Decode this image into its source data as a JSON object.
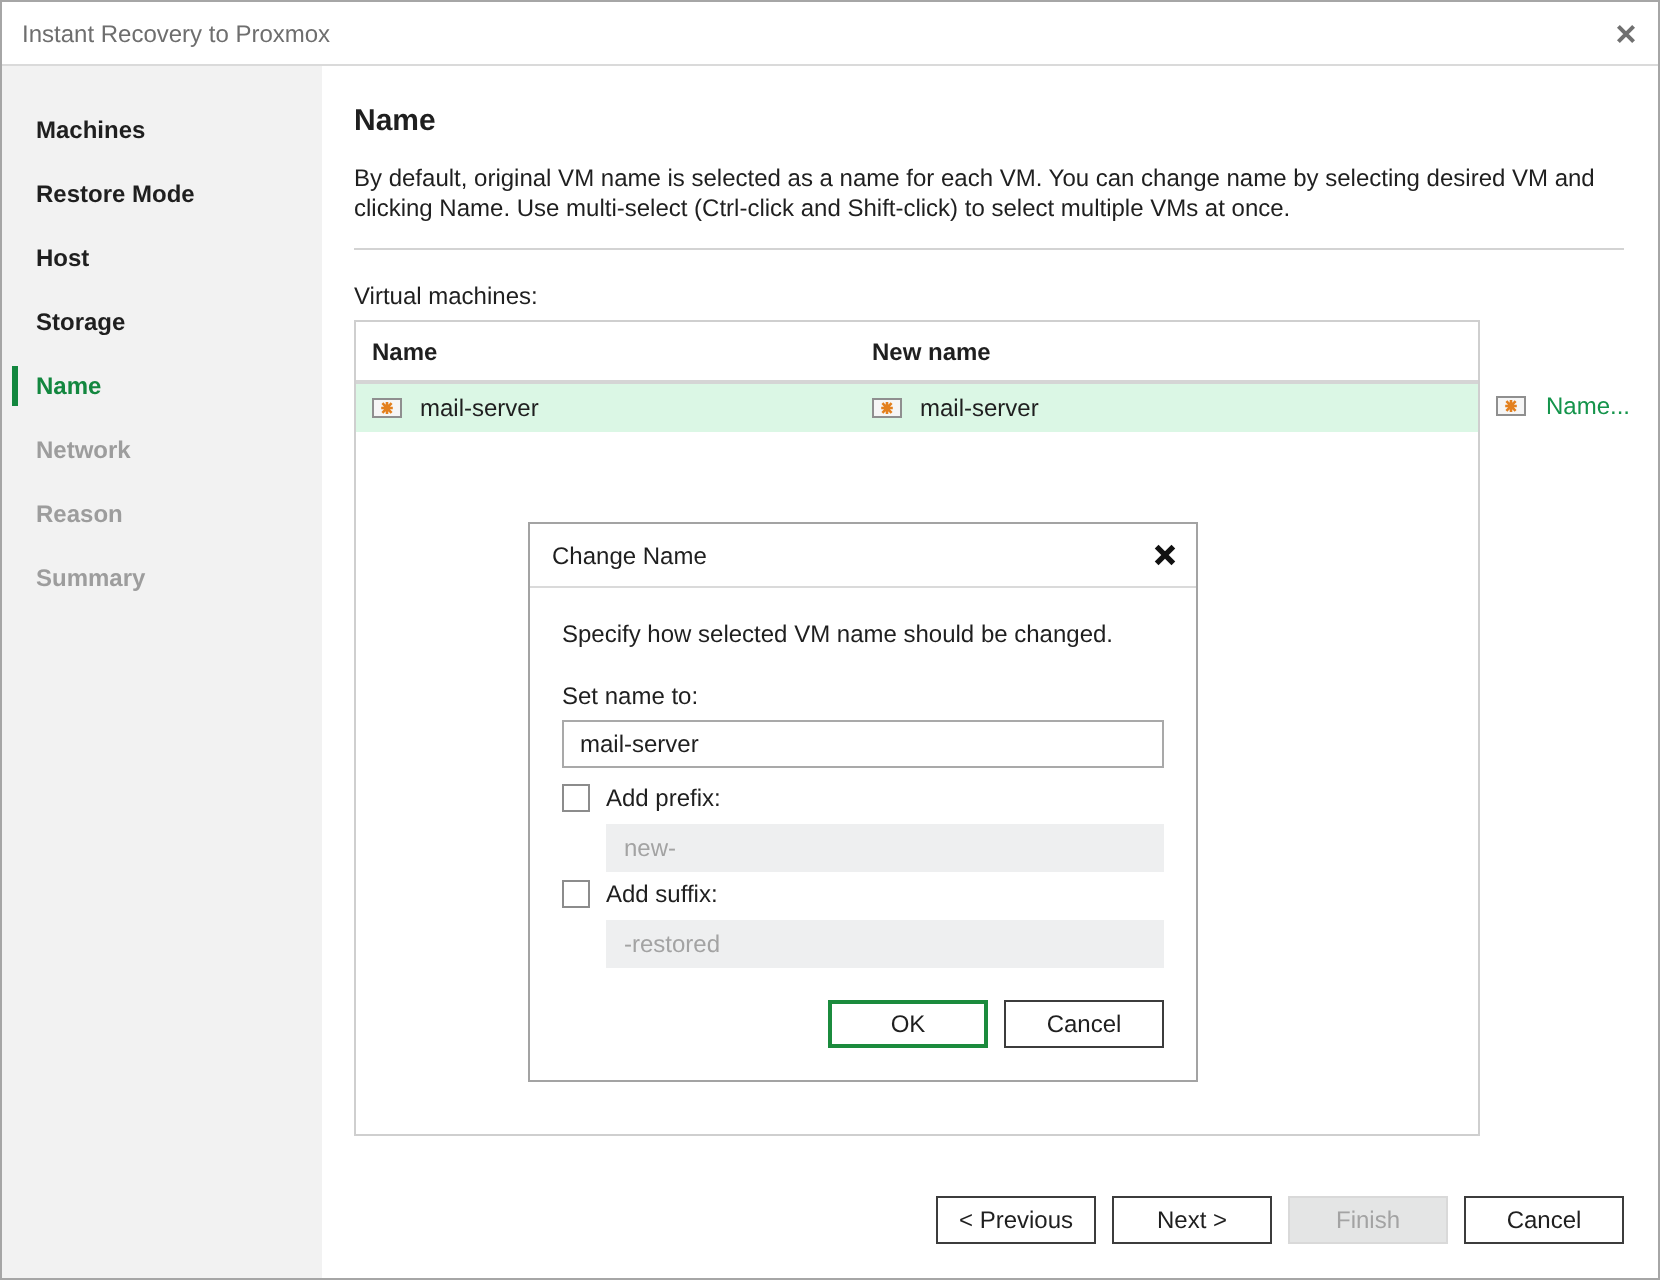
{
  "window": {
    "title": "Instant Recovery to Proxmox"
  },
  "sidebar": {
    "items": [
      {
        "label": "Machines",
        "selected": false,
        "disabled": false
      },
      {
        "label": "Restore Mode",
        "selected": false,
        "disabled": false
      },
      {
        "label": "Host",
        "selected": false,
        "disabled": false
      },
      {
        "label": "Storage",
        "selected": false,
        "disabled": false
      },
      {
        "label": "Name",
        "selected": true,
        "disabled": false
      },
      {
        "label": "Network",
        "selected": false,
        "disabled": true
      },
      {
        "label": "Reason",
        "selected": false,
        "disabled": true
      },
      {
        "label": "Summary",
        "selected": false,
        "disabled": true
      }
    ]
  },
  "page": {
    "heading": "Name",
    "description": "By default, original VM name is selected as a name for each VM. You can change name by selecting desired VM and clicking Name. Use multi-select (Ctrl-click and Shift-click) to select multiple VMs at once."
  },
  "table": {
    "caption": "Virtual machines:",
    "columns": [
      "Name",
      "New name"
    ],
    "rows": [
      {
        "cells": [
          "mail-server",
          "mail-server"
        ],
        "selected": true
      }
    ],
    "action": {
      "label": "Name..."
    }
  },
  "dialog": {
    "title": "Change Name",
    "instruction": "Specify how selected VM name should be changed.",
    "name_label": "Set name to:",
    "name_value": "mail-server",
    "options": [
      {
        "label": "Add prefix:",
        "checked": false,
        "value": "new-",
        "disabled": true
      },
      {
        "label": "Add suffix:",
        "checked": false,
        "value": "-restored",
        "disabled": true
      }
    ],
    "buttons": [
      {
        "label": "OK",
        "default": true
      },
      {
        "label": "Cancel",
        "default": false
      }
    ]
  },
  "footer": {
    "buttons": [
      {
        "label": "< Previous",
        "disabled": false
      },
      {
        "label": "Next >",
        "disabled": false
      },
      {
        "label": "Finish",
        "disabled": true
      },
      {
        "label": "Cancel",
        "disabled": false
      }
    ]
  }
}
